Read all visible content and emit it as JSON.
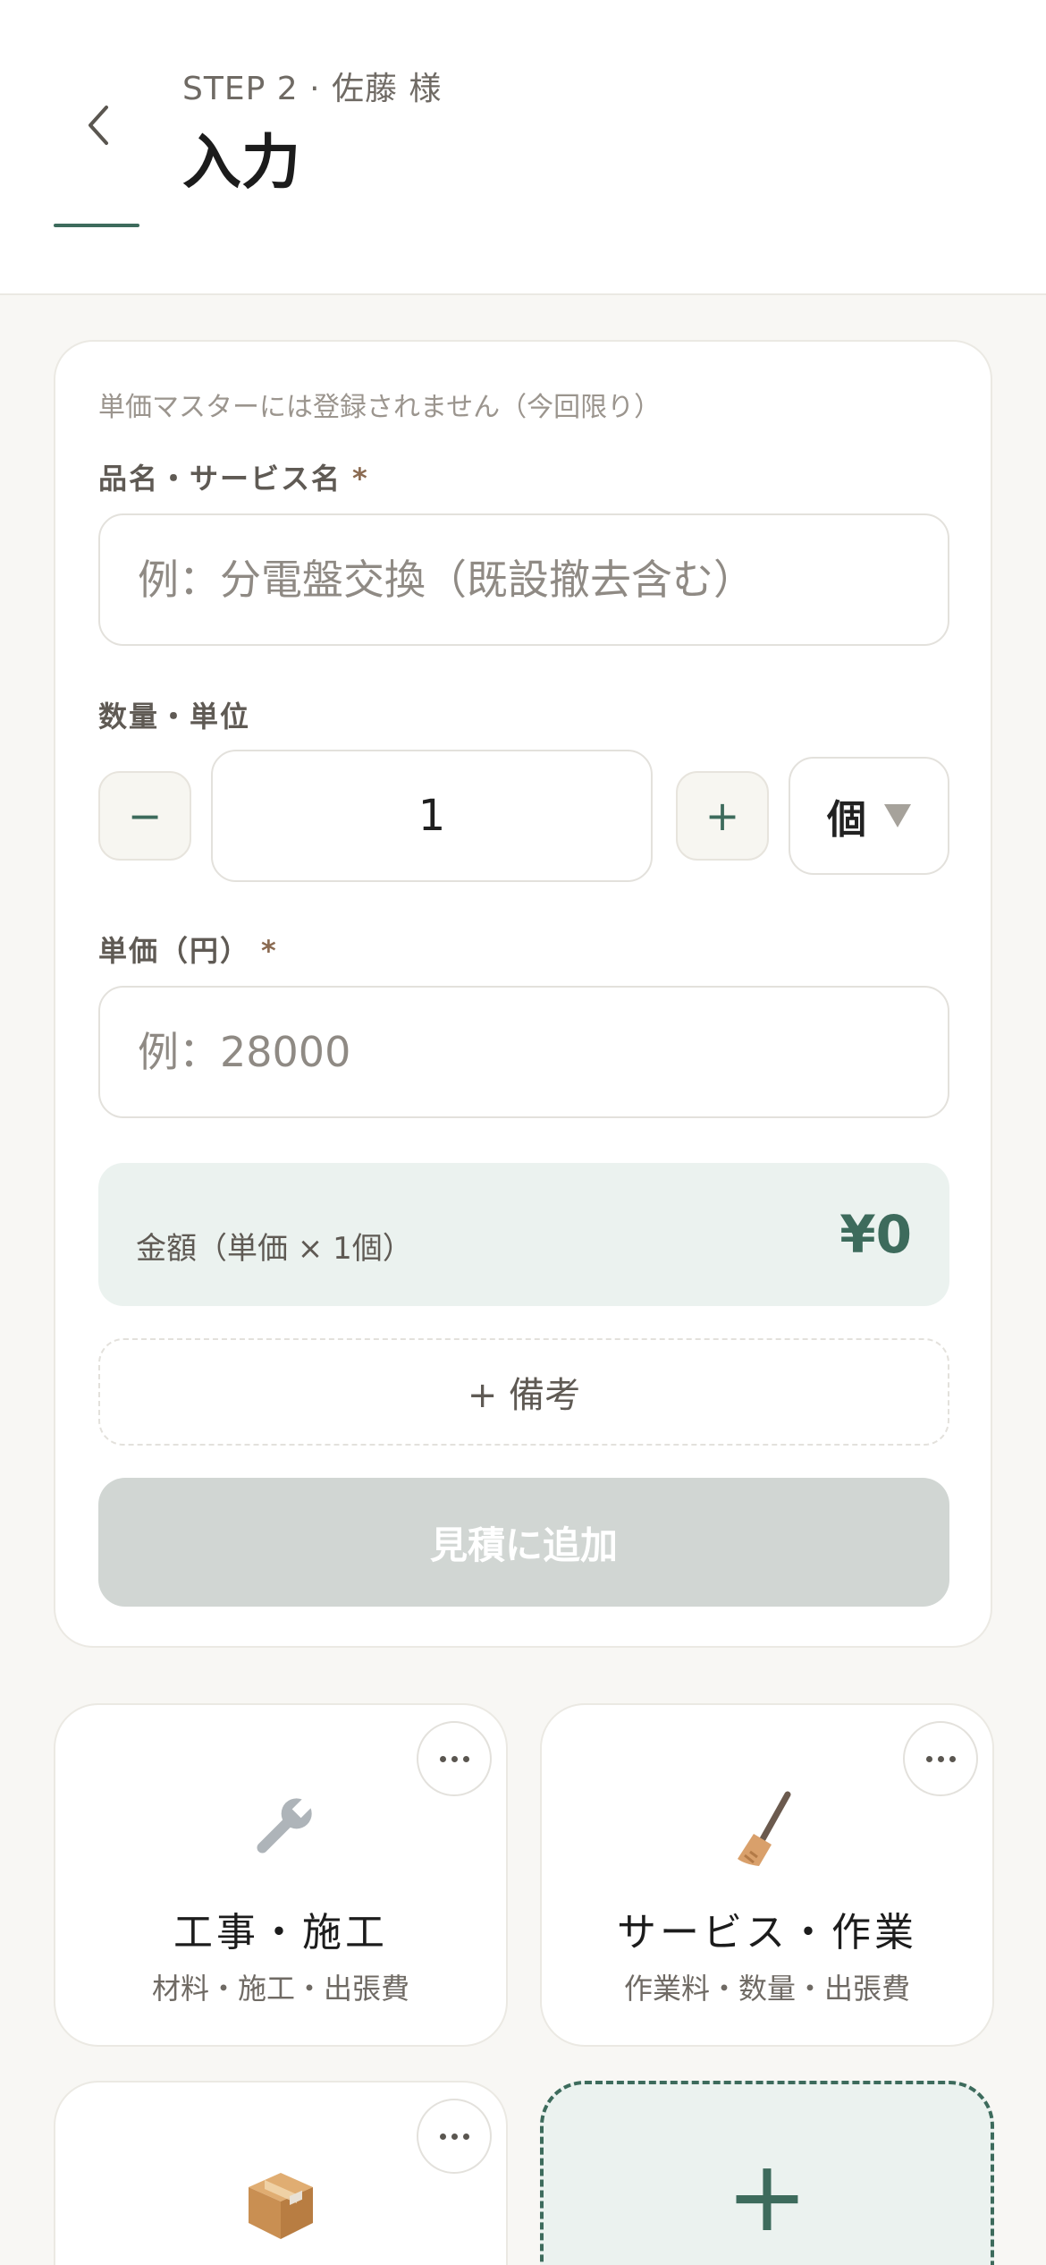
{
  "header": {
    "step": "STEP 2 · 佐藤 様",
    "title": "入力"
  },
  "form": {
    "note": "単価マスターには登録されません（今回限り）",
    "item_name": {
      "label": "品名・サービス名",
      "required_mark": "*",
      "placeholder": "例：分電盤交換（既設撤去含む）",
      "value": ""
    },
    "quantity": {
      "label": "数量・単位",
      "minus": "−",
      "plus": "+",
      "value": "1",
      "unit": "個"
    },
    "unit_price": {
      "label": "単価（円）",
      "required_mark": "*",
      "placeholder": "例：28000",
      "value": ""
    },
    "amount": {
      "label": "金額（単価 × 1個）",
      "value": "¥0"
    },
    "remark_button": "+ 備考",
    "submit_button": "見積に追加"
  },
  "categories": [
    {
      "icon": "wrench-icon",
      "name": "工事・施工",
      "sub": "材料・施工・出張費"
    },
    {
      "icon": "broom-icon",
      "name": "サービス・作業",
      "sub": "作業料・数量・出張費"
    },
    {
      "icon": "package-icon",
      "name": "",
      "sub": ""
    }
  ],
  "colors": {
    "accent": "#3d6b5c",
    "amount_bg": "#ebf2ef",
    "disabled_button": "#d1d6d3",
    "background": "#f8f7f4"
  }
}
